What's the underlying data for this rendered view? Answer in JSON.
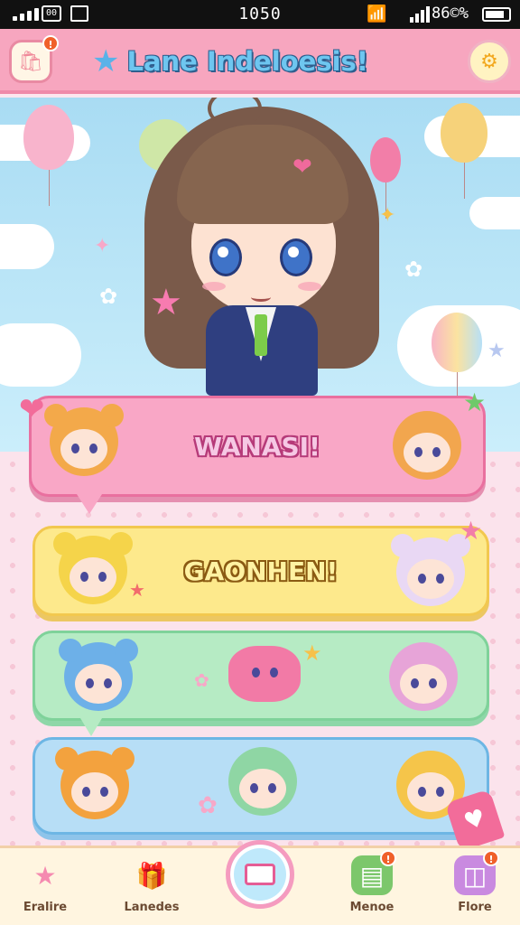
{
  "status_bar": {
    "time": "1050",
    "carrier_icon": "sim-icon",
    "battery_percent": "86%",
    "battery_display": "86©%"
  },
  "header": {
    "title": "Lane Indeloesis!",
    "left_button_icon": "shop-bag-icon",
    "left_badge": "!",
    "right_button_icon": "gear-icon"
  },
  "panels": [
    {
      "label": "WANASI!",
      "color": "#f9a7c6"
    },
    {
      "label": "GAONHEN!",
      "color": "#fde98c"
    },
    {
      "label": "",
      "color": "#b6ebc4"
    },
    {
      "label": "",
      "color": "#b7def6"
    }
  ],
  "nav": {
    "items": [
      {
        "label": "Eralire",
        "icon": "star-icon"
      },
      {
        "label": "Lanedes",
        "icon": "gift-icon"
      },
      {
        "label": "",
        "icon": "envelope-icon"
      },
      {
        "label": "Menoe",
        "icon": "book-icon",
        "badge": "!"
      },
      {
        "label": "Flore",
        "icon": "robot-icon",
        "badge": "!"
      }
    ]
  }
}
